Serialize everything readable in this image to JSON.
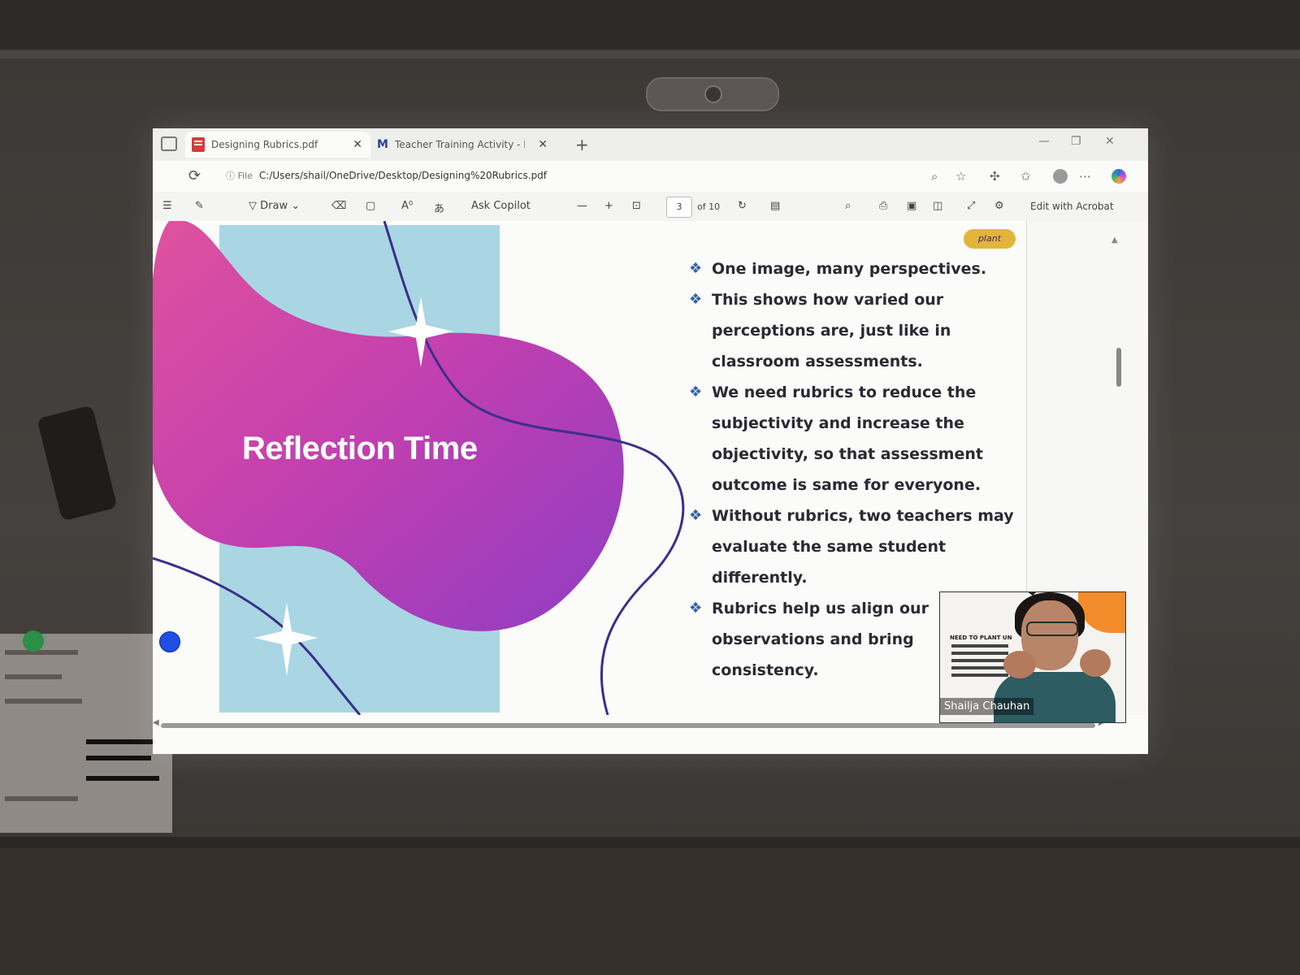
{
  "browser": {
    "tabs": [
      {
        "title": "Designing Rubrics.pdf",
        "icon": "pdf-icon",
        "active": true
      },
      {
        "title": "Teacher Training Activity - Menti",
        "icon": "mentimeter-icon",
        "active": false
      }
    ],
    "address": {
      "scheme_label": "File",
      "url": "C:/Users/shail/OneDrive/Desktop/Designing%20Rubrics.pdf"
    }
  },
  "pdf_toolbar": {
    "draw_label": "Draw",
    "ask_copilot_label": "Ask Copilot",
    "page_current": "3",
    "page_total": "of 10",
    "edit_acrobat_label": "Edit with Acrobat"
  },
  "slide": {
    "title": "Reflection Time",
    "bullets": [
      "One image, many perspectives.",
      "This shows how varied our perceptions are, just like in classroom assessments.",
      "We need rubrics to reduce the subjectivity and increase the objectivity, so that assessment outcome is same for everyone.",
      "Without rubrics, two teachers may evaluate the same student differently.",
      "Rubrics help us align our observations and bring consistency."
    ],
    "bullet_glyph": "❖",
    "colors": {
      "blob_pink": "#d9469e",
      "blob_purple": "#8a3fc2",
      "panel_blue": "#a9d6e2",
      "curve": "#3b2f8a"
    }
  },
  "video_tile": {
    "participant_name": "Shailja Chauhan",
    "slide_heading": "NEED TO PLANT UN"
  }
}
